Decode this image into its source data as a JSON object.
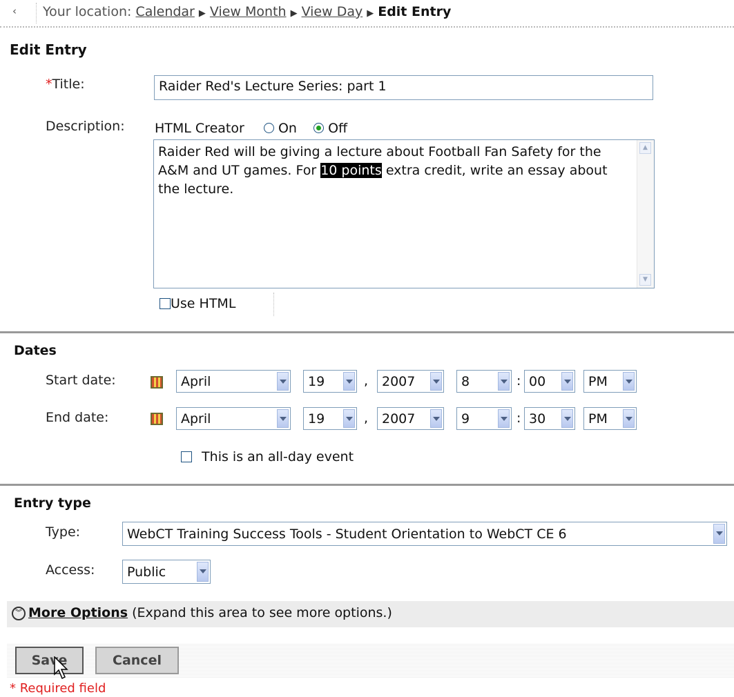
{
  "breadcrumb": {
    "back_glyph": "‹",
    "prefix": "Your location:",
    "items": [
      "Calendar",
      "View Month",
      "View Day"
    ],
    "current": "Edit Entry"
  },
  "edit_entry": {
    "heading": "Edit Entry",
    "title_required_mark": "*",
    "title_label": "Title:",
    "title_value": "Raider Red's Lecture Series: part 1",
    "description_label": "Description:",
    "html_creator_label": "HTML Creator",
    "html_creator_on": "On",
    "html_creator_off": "Off",
    "html_creator_selected": "Off",
    "description_text_before": "Raider Red will be giving a lecture about Football Fan Safety for the A&M and UT games.  For ",
    "description_text_highlight": "10 points",
    "description_text_after": " extra credit, write an essay about the lecture.",
    "use_html_label": "Use HTML",
    "use_html_checked": false
  },
  "dates": {
    "heading": "Dates",
    "start_label": "Start date:",
    "end_label": "End date:",
    "start": {
      "month": "April",
      "day": "19",
      "year": "2007",
      "hour": "8",
      "minute": "00",
      "ampm": "PM"
    },
    "end": {
      "month": "April",
      "day": "19",
      "year": "2007",
      "hour": "9",
      "minute": "30",
      "ampm": "PM"
    },
    "comma": ",",
    "colon": ":",
    "all_day_label": "This is an all-day event",
    "all_day_checked": false
  },
  "entry_type": {
    "heading": "Entry type",
    "type_label": "Type:",
    "type_value": "WebCT Training Success Tools - Student Orientation to WebCT CE 6",
    "access_label": "Access:",
    "access_value": "Public"
  },
  "more_options": {
    "link": "More Options",
    "hint": "(Expand this area to see more options.)"
  },
  "actions": {
    "save": "Save",
    "cancel": "Cancel"
  },
  "footer": {
    "required_note": "* Required field"
  },
  "colors": {
    "required": "#e02020",
    "highlight_bg": "#000000",
    "separator": "#999999"
  }
}
